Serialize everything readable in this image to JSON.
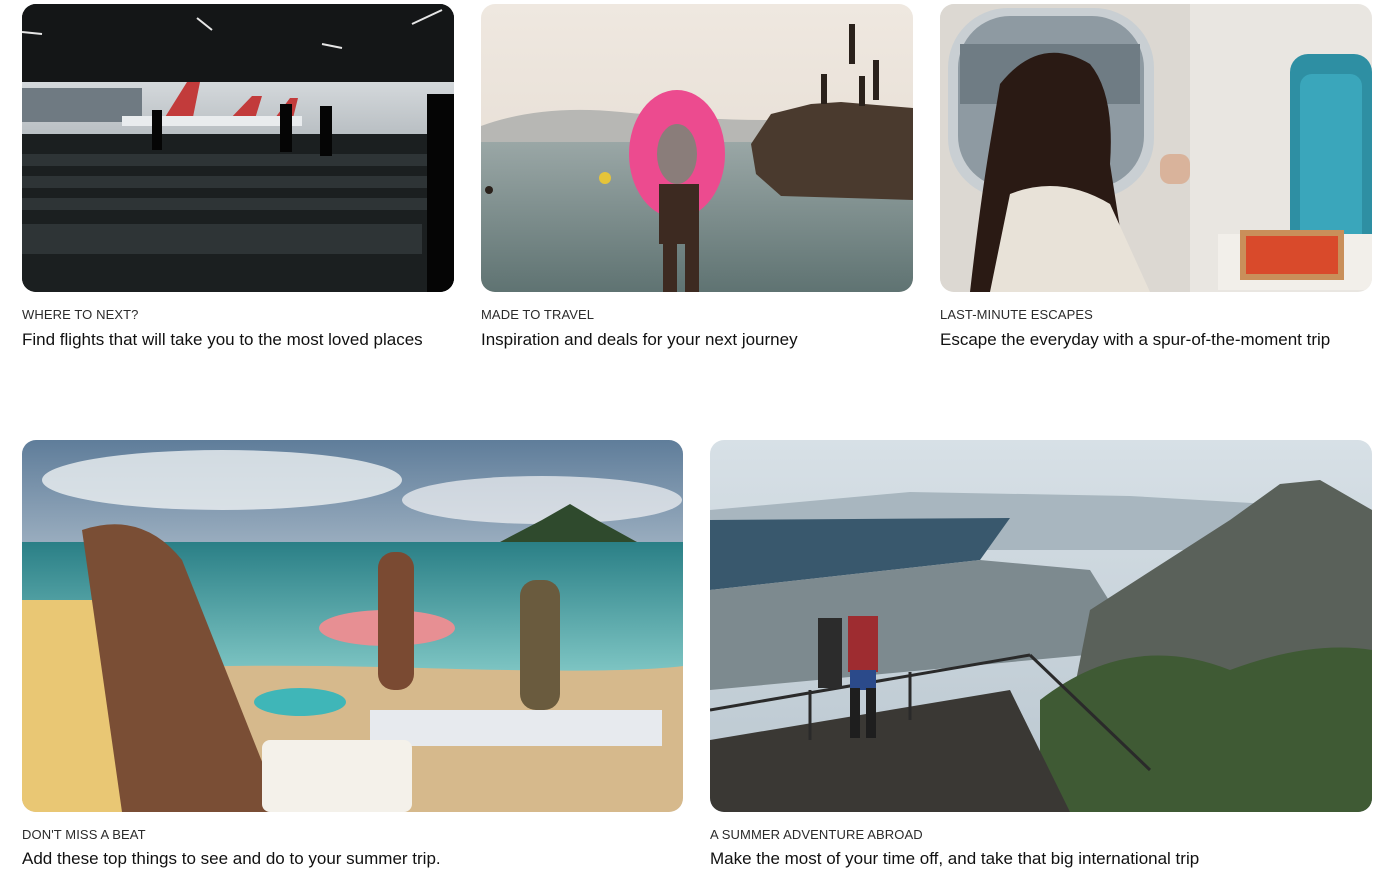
{
  "cards": [
    {
      "eyebrow": "WHERE TO NEXT?",
      "headline": "Find flights that will take you to the most loved places",
      "image": "airport-terminal-photo"
    },
    {
      "eyebrow": "MADE TO TRAVEL",
      "headline": "Inspiration and deals for your next journey",
      "image": "beach-swim-ring-photo"
    },
    {
      "eyebrow": "LAST-MINUTE ESCAPES",
      "headline": "Escape the everyday with a spur-of-the-moment trip",
      "image": "airplane-window-seat-photo"
    },
    {
      "eyebrow": "DON'T MISS A BEAT",
      "headline": "Add these top things to see and do to your summer trip.",
      "image": "family-beach-day-photo"
    },
    {
      "eyebrow": "A SUMMER ADVENTURE ABROAD",
      "headline": "Make the most of your time off, and take that big international trip",
      "image": "mountain-viewpoint-city-photo"
    }
  ]
}
